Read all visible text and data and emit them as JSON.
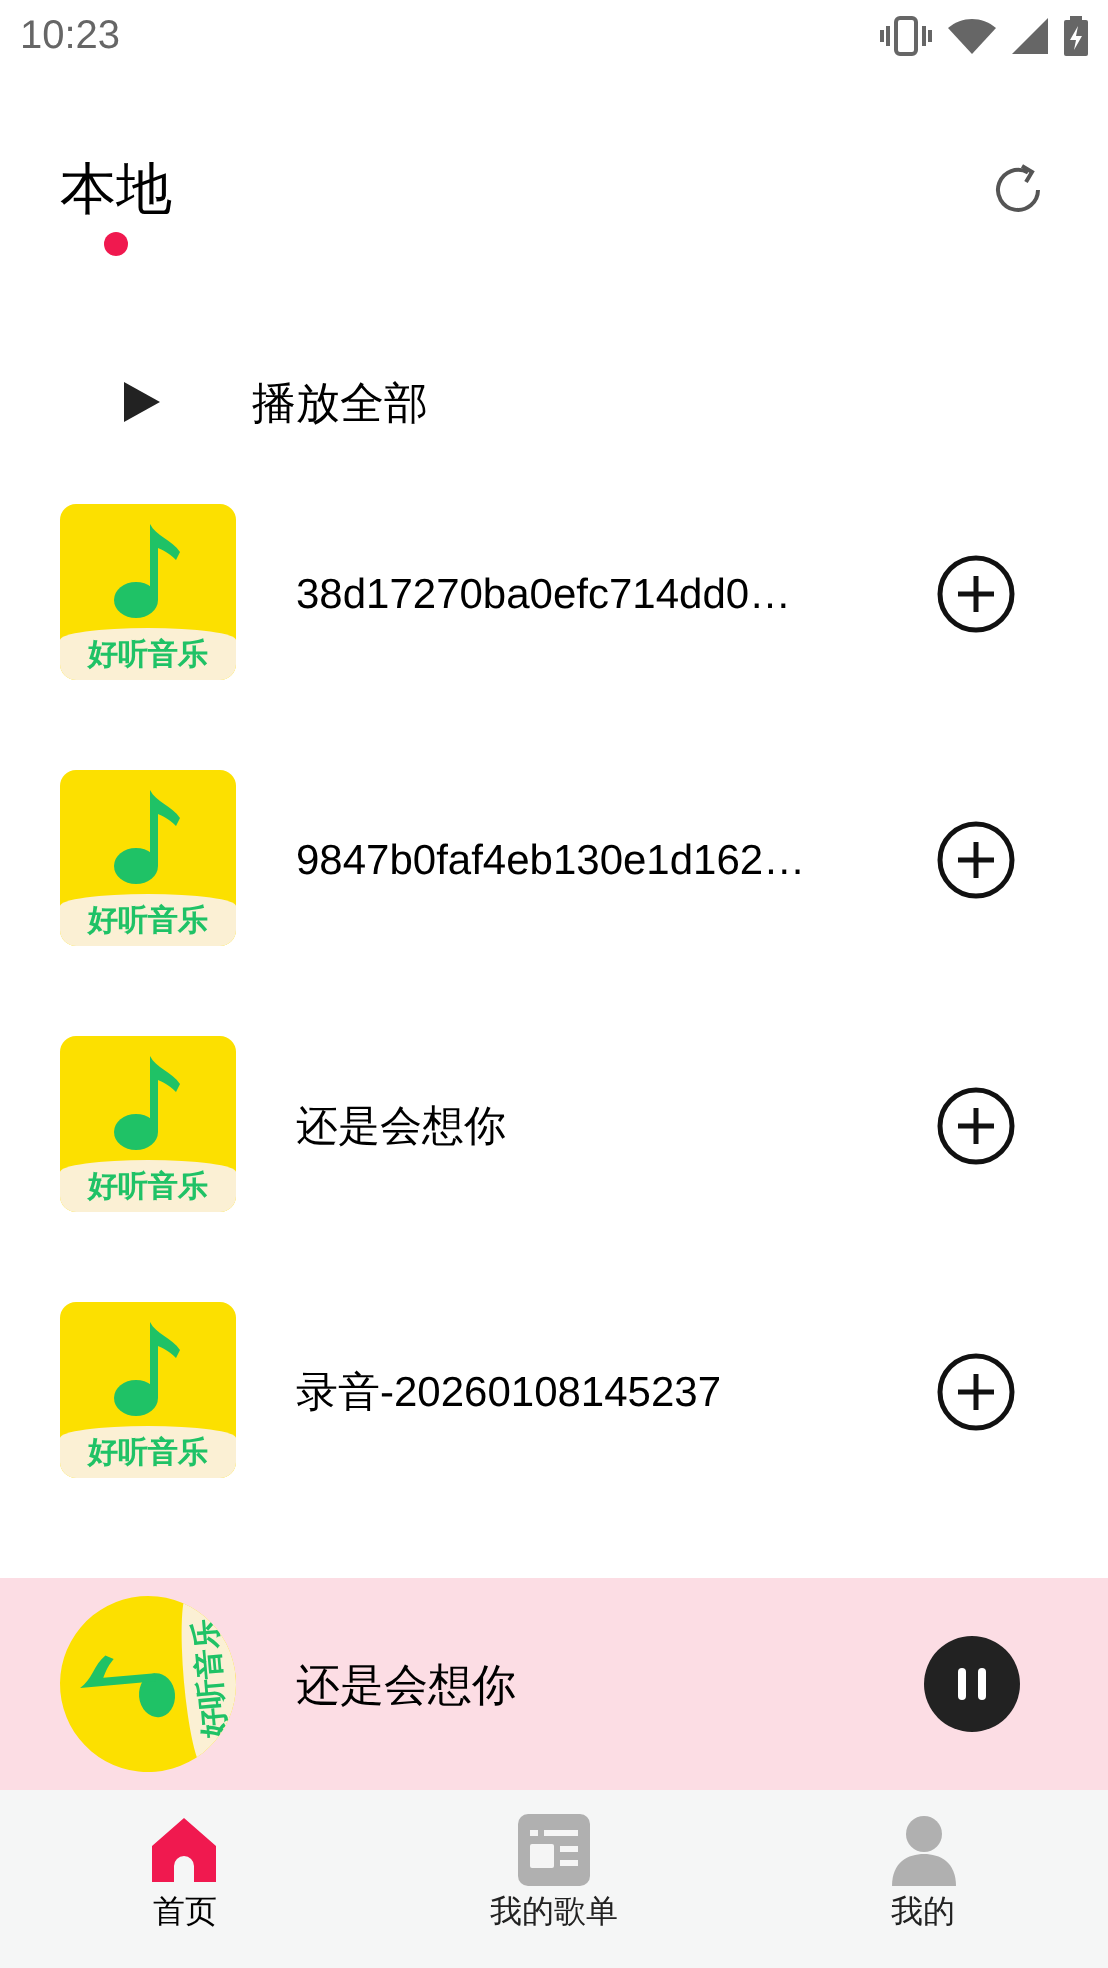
{
  "status_bar": {
    "time": "10:23"
  },
  "header": {
    "title": "本地",
    "selected": true
  },
  "play_all": {
    "label": "播放全部"
  },
  "songs": [
    {
      "title": "38d17270ba0efc714dd0…",
      "cover_text": "好听音乐"
    },
    {
      "title": "9847b0faf4eb130e1d162…",
      "cover_text": "好听音乐"
    },
    {
      "title": "还是会想你",
      "cover_text": "好听音乐"
    },
    {
      "title": "录音-20260108145237",
      "cover_text": "好听音乐"
    }
  ],
  "player": {
    "title": "还是会想你",
    "cover_text": "好听音乐",
    "playing": true
  },
  "tabs": [
    {
      "label": "首页",
      "kind": "home",
      "selected": true
    },
    {
      "label": "我的歌单",
      "kind": "playlist",
      "selected": false
    },
    {
      "label": "我的",
      "kind": "profile",
      "selected": false
    }
  ]
}
